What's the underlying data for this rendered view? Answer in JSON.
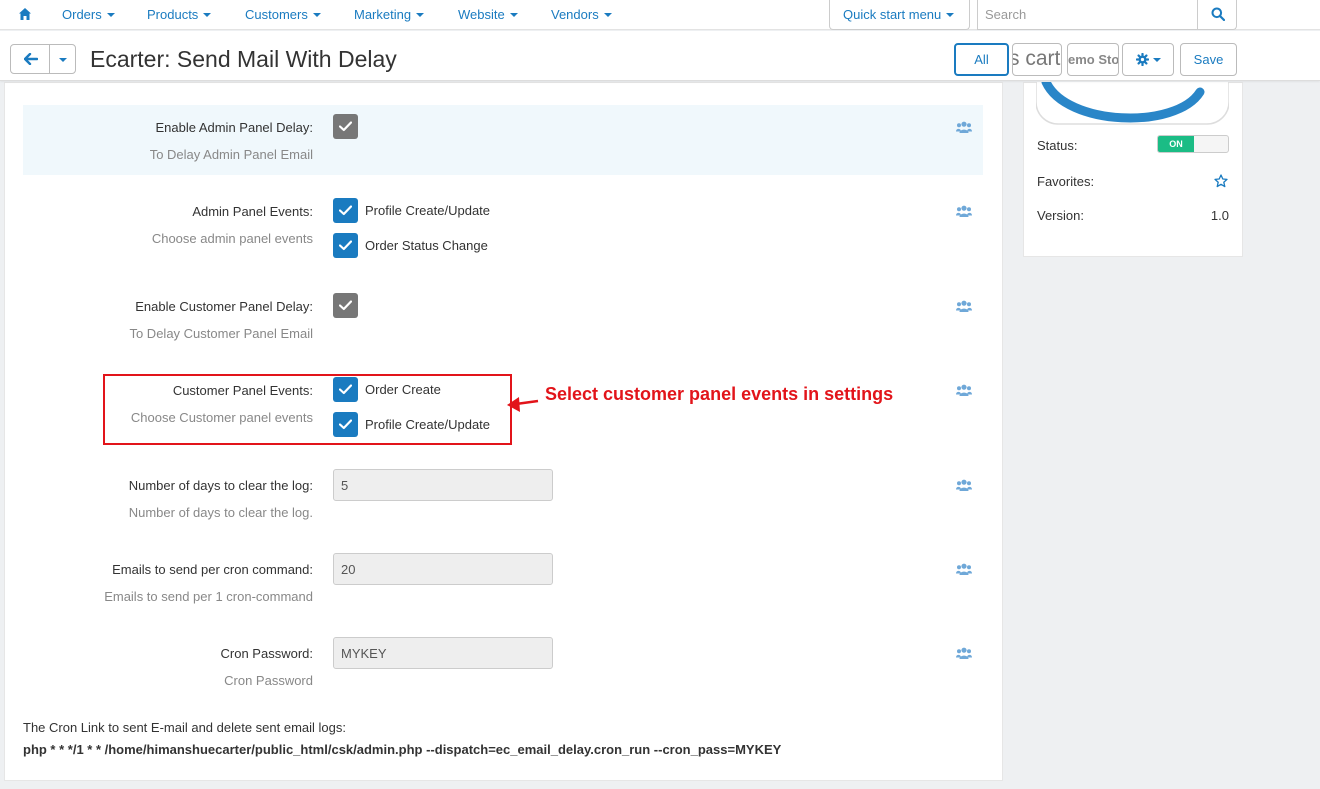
{
  "nav": {
    "items": [
      {
        "label": "Orders"
      },
      {
        "label": "Products"
      },
      {
        "label": "Customers"
      },
      {
        "label": "Marketing"
      },
      {
        "label": "Website"
      },
      {
        "label": "Vendors"
      }
    ],
    "quick_start": "Quick start menu",
    "search_placeholder": "Search"
  },
  "header": {
    "title": "Ecarter: Send Mail With Delay",
    "all_label": "All",
    "logo_cart": "s cart",
    "logo_demo": "emo Sto",
    "save_label": "Save"
  },
  "settings": {
    "admin_delay": {
      "label": "Enable Admin Panel Delay:",
      "hint": "To Delay Admin Panel Email"
    },
    "admin_events": {
      "label": "Admin Panel Events:",
      "hint": "Choose admin panel events",
      "opt1": "Profile Create/Update",
      "opt2": "Order Status Change"
    },
    "customer_delay": {
      "label": "Enable Customer Panel Delay:",
      "hint": "To Delay Customer Panel Email"
    },
    "customer_events": {
      "label": "Customer Panel Events:",
      "hint": "Choose Customer panel events",
      "opt1": "Order Create",
      "opt2": "Profile Create/Update"
    },
    "clear_days": {
      "label": "Number of days to clear the log:",
      "hint": "Number of days to clear the log.",
      "value": "5"
    },
    "emails_per_cron": {
      "label": "Emails to send per cron command:",
      "hint": "Emails to send per 1 cron-command",
      "value": "20"
    },
    "cron_password": {
      "label": "Cron Password:",
      "hint": "Cron Password",
      "value": "MYKEY"
    }
  },
  "cron": {
    "note": "The Cron Link to sent E-mail and delete sent email logs:",
    "command": "php * * */1 * * /home/himanshuecarter/public_html/csk/admin.php --dispatch=ec_email_delay.cron_run --cron_pass=MYKEY"
  },
  "annotation": {
    "text": "Select customer panel events in settings"
  },
  "sidebar": {
    "status_label": "Status:",
    "status_value": "ON",
    "favorites_label": "Favorites:",
    "version_label": "Version:",
    "version_value": "1.0"
  },
  "colors": {
    "accent": "#1a7bc0",
    "annotation": "#e2141a",
    "toggle_on": "#1bbc85"
  }
}
